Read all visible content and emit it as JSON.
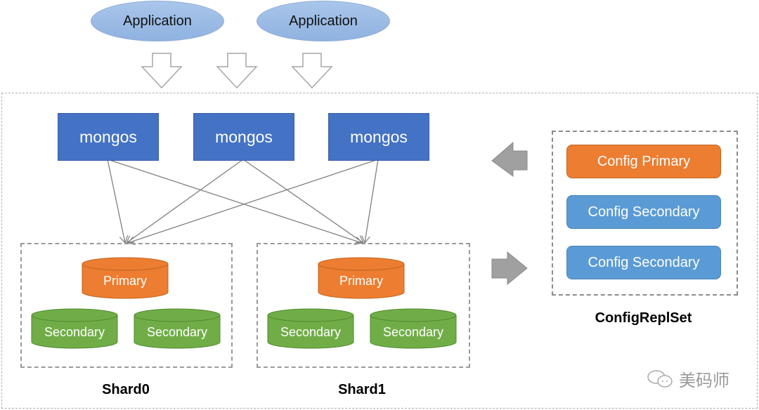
{
  "applications": [
    {
      "label": "Application"
    },
    {
      "label": "Application"
    }
  ],
  "mongos": [
    {
      "label": "mongos"
    },
    {
      "label": "mongos"
    },
    {
      "label": "mongos"
    }
  ],
  "shards": [
    {
      "caption": "Shard0",
      "primary": "Primary",
      "secondaries": [
        "Secondary",
        "Secondary"
      ]
    },
    {
      "caption": "Shard1",
      "primary": "Primary",
      "secondaries": [
        "Secondary",
        "Secondary"
      ]
    }
  ],
  "config": {
    "caption": "ConfigReplSet",
    "members": [
      "Config Primary",
      "Config Secondary",
      "Config Secondary"
    ]
  },
  "watermark": {
    "icon": "wechat-icon",
    "text": "美码师"
  },
  "colors": {
    "mongos": "#4472c4",
    "primary": "#ed7d31",
    "secondary": "#70ad47",
    "config_secondary": "#5b9bd5",
    "connector": "#808080"
  }
}
